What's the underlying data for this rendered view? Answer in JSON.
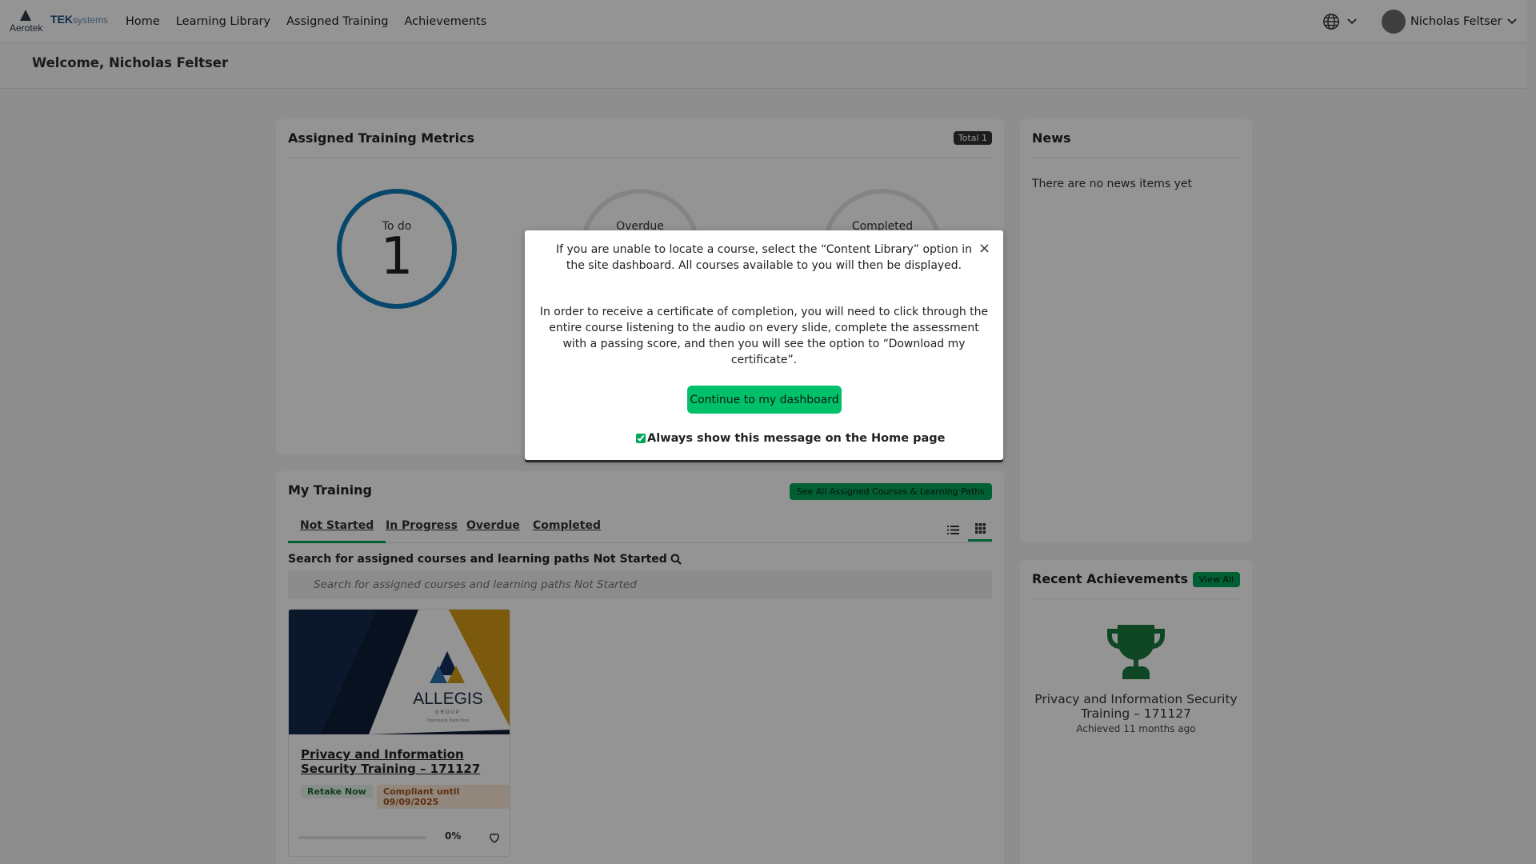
{
  "topbar": {
    "brand_primary": "Aerotek",
    "brand_secondary_bold": "TEK",
    "brand_secondary_light": "systems",
    "nav": [
      "Home",
      "Learning Library",
      "Assigned Training",
      "Achievements"
    ],
    "language_icon": "globe-icon",
    "user_name": "Nicholas Feltser"
  },
  "welcome": "Welcome, Nicholas Feltser",
  "metrics": {
    "title": "Assigned Training Metrics",
    "total_badge": "Total 1",
    "todo_label": "To do",
    "todo_value": "1",
    "overdue_label": "Overdue",
    "completed_label": "Completed",
    "accent": "#0d7ab8"
  },
  "training": {
    "title": "My Training",
    "see_all": "See All Assigned Courses & Learning Paths",
    "tabs": [
      "Not Started",
      "In Progress",
      "Overdue",
      "Completed"
    ],
    "active_tab": "Not Started",
    "search_label": "Search for assigned courses and learning paths Not Started",
    "search_placeholder": "Search for assigned courses and learning paths Not Started",
    "course": {
      "image_brand": "ALLEGIS",
      "image_brand_sub": "GROUP",
      "image_tagline": "Opportunity Starts Here",
      "title": "Privacy and Information Security Training – 171127",
      "retake": "Retake Now",
      "compliant": "Compliant until 09/09/2025",
      "progress_label": "0%",
      "progress_value": 0
    }
  },
  "news": {
    "title": "News",
    "empty": "There are no news items yet"
  },
  "achievements": {
    "title": "Recent Achievements",
    "view_all": "View All",
    "item_title": "Privacy and Information Security Training – 171127",
    "item_date": "Achieved 11 months ago",
    "trophy_color": "#1a7a40"
  },
  "modal": {
    "para1": "If you are unable to locate a course, select the “Content Library” option in the site dashboard. All courses available to you will then be displayed.",
    "para2": "In order to receive a certificate of completion, you will need to click through the entire course listening to the audio on every slide, complete the assessment with a passing score, and then you will see the option to “Download my certificate”.",
    "close": "×",
    "continue_button": "Continue to my dashboard",
    "checkbox_label": "Always show this message on the Home page",
    "checkbox_checked": true
  },
  "colors": {
    "green": "#00a65a",
    "modal_button": "#00c16a"
  }
}
